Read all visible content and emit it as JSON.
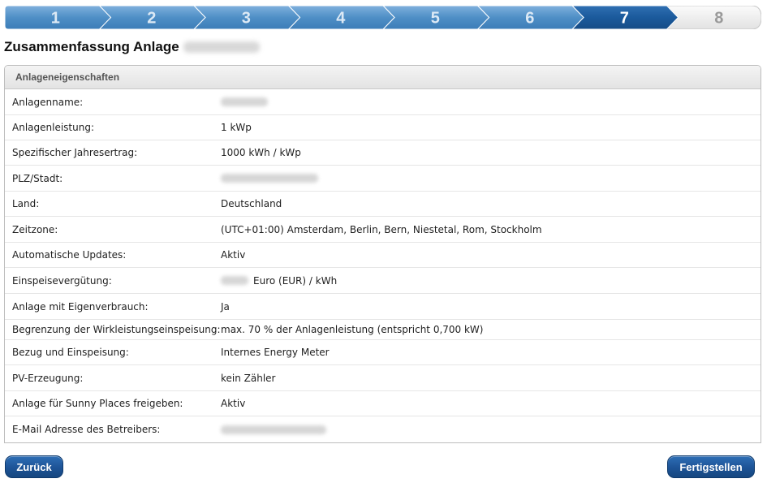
{
  "wizard": {
    "steps": [
      "1",
      "2",
      "3",
      "4",
      "5",
      "6",
      "7",
      "8"
    ],
    "active_step": "7"
  },
  "title": "Zusammenfassung Anlage",
  "panel": {
    "header": "Anlageneigenschaften",
    "rows": [
      {
        "label": "Anlagenname:",
        "value": ""
      },
      {
        "label": "Anlagenleistung:",
        "value": "1 kWp"
      },
      {
        "label": "Spezifischer Jahresertrag:",
        "value": "1000 kWh / kWp"
      },
      {
        "label": "PLZ/Stadt:",
        "value": ""
      },
      {
        "label": "Land:",
        "value": "Deutschland"
      },
      {
        "label": "Zeitzone:",
        "value": "(UTC+01:00) Amsterdam, Berlin, Bern, Niestetal, Rom, Stockholm"
      },
      {
        "label": "Automatische Updates:",
        "value": "Aktiv"
      },
      {
        "label": "Einspeisevergütung:",
        "value": "Euro (EUR) / kWh"
      },
      {
        "label": "Anlage mit Eigenverbrauch:",
        "value": "Ja"
      },
      {
        "label": "Begrenzung der Wirkleistungseinspeisung:",
        "value": "max. 70 % der Anlagenleistung (entspricht 0,700 kW)"
      },
      {
        "label": "Bezug und Einspeisung:",
        "value": "Internes Energy Meter"
      },
      {
        "label": "PV-Erzeugung:",
        "value": "kein Zähler"
      },
      {
        "label": "Anlage für Sunny Places freigeben:",
        "value": "Aktiv"
      },
      {
        "label": "E-Mail Adresse des Betreibers:",
        "value": ""
      }
    ]
  },
  "buttons": {
    "back": "Zurück",
    "finish": "Fertigstellen"
  },
  "colors": {
    "step_done": "#4f8fc6",
    "step_active": "#1b5a9c",
    "step_todo": "#e9e9e9",
    "button": "#1d5396"
  }
}
